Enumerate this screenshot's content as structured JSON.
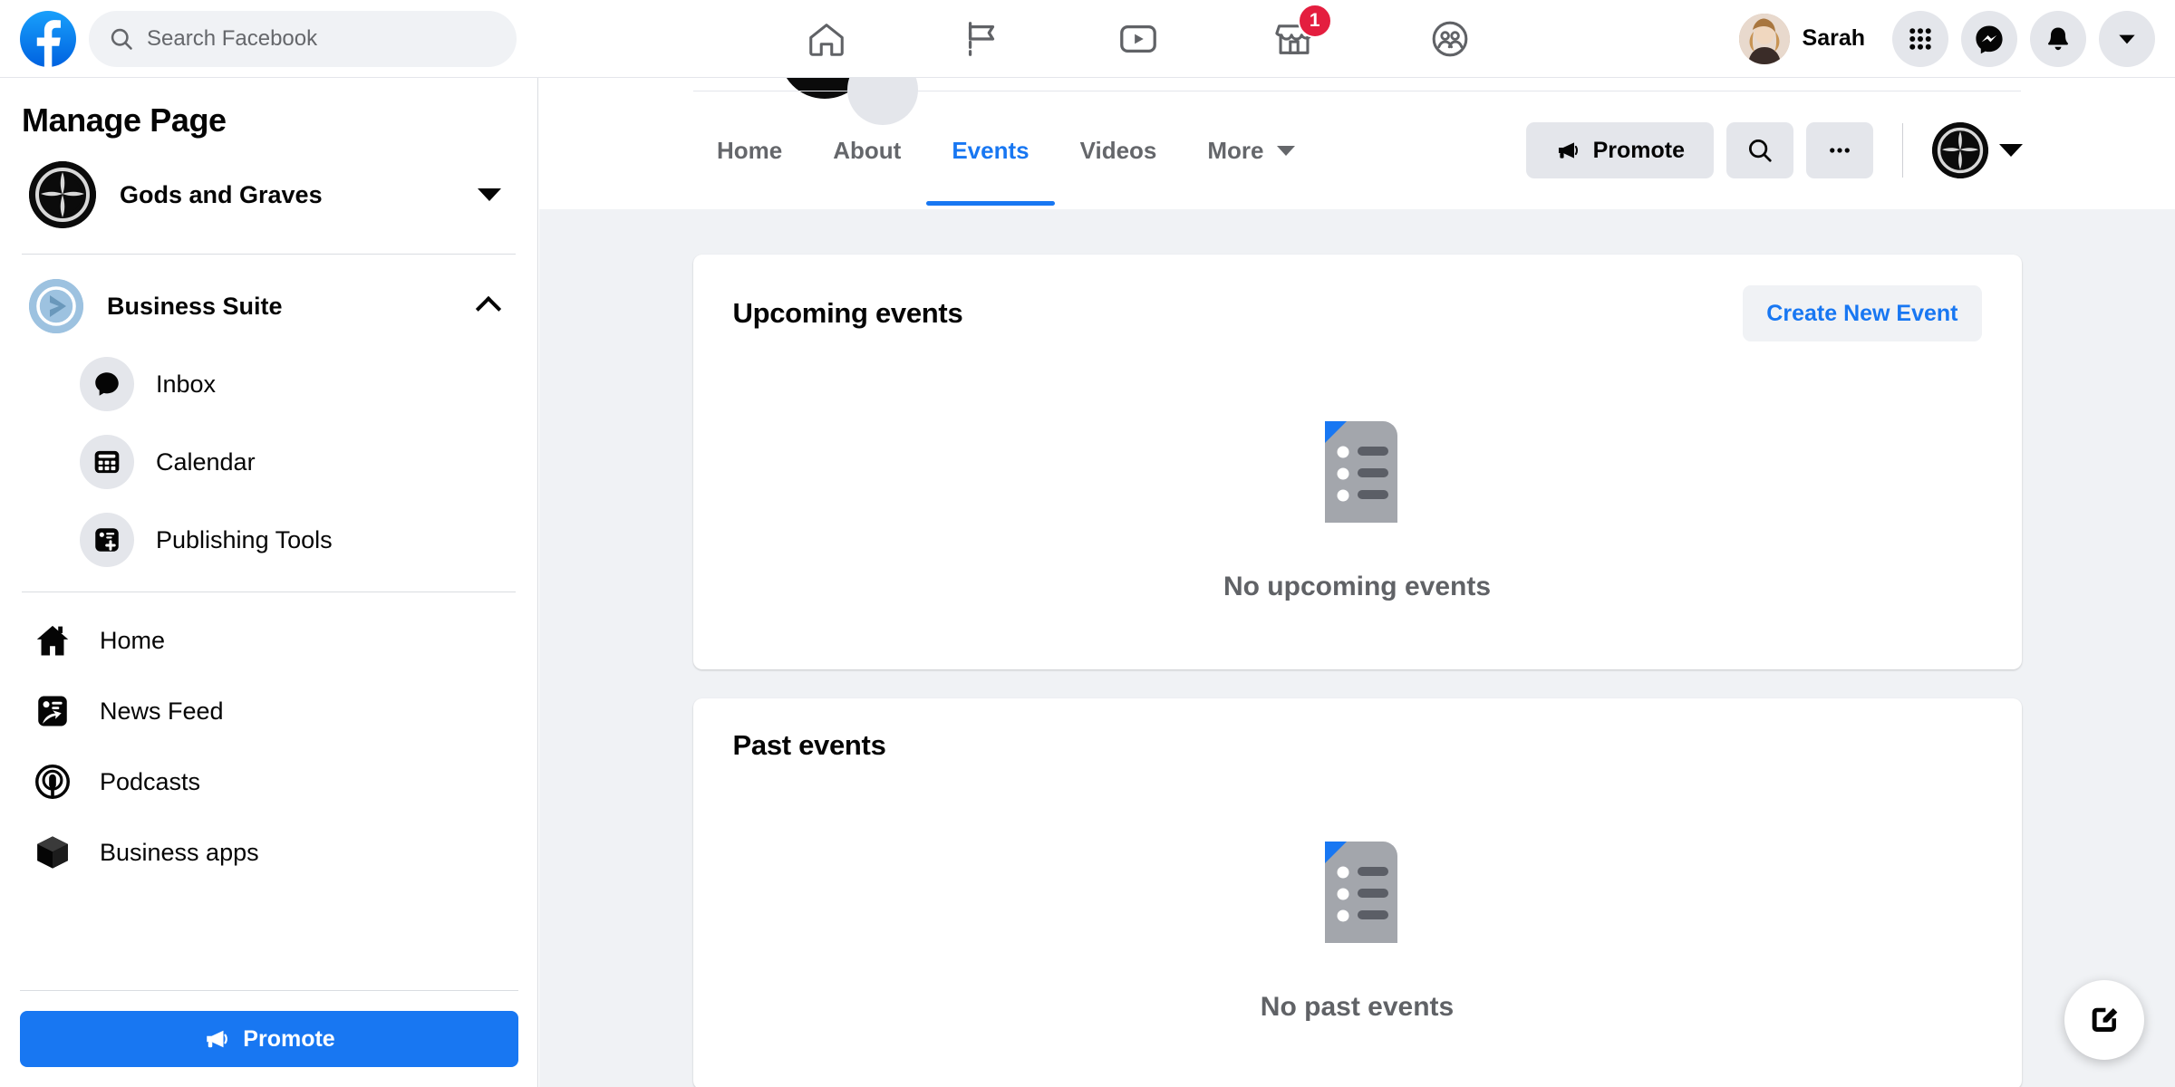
{
  "topbar": {
    "logo_icon": "facebook-logo",
    "search": {
      "placeholder": "Search Facebook",
      "value": "",
      "icon": "search-icon"
    },
    "nav": [
      {
        "icon": "home-icon",
        "name": "home",
        "badge": ""
      },
      {
        "icon": "flag-icon",
        "name": "pages",
        "badge": ""
      },
      {
        "icon": "video-play-icon",
        "name": "watch",
        "badge": ""
      },
      {
        "icon": "marketplace-store-icon",
        "name": "marketplace",
        "badge": "1"
      },
      {
        "icon": "groups-people-icon",
        "name": "groups",
        "badge": ""
      }
    ],
    "user": {
      "name": "Sarah",
      "avatar_icon": "user-avatar"
    },
    "actions": [
      {
        "icon": "grid-menu-icon",
        "name": "menu"
      },
      {
        "icon": "messenger-icon",
        "name": "messenger"
      },
      {
        "icon": "bell-icon",
        "name": "notifications"
      },
      {
        "icon": "chevron-down-icon",
        "name": "account"
      }
    ]
  },
  "sidebar": {
    "title": "Manage Page",
    "page": {
      "name": "Gods and Graves",
      "logo_icon": "gods-and-graves-logo",
      "caret_icon": "caret-down-icon"
    },
    "business_suite": {
      "label": "Business Suite",
      "icon": "business-suite-icon",
      "chevron_icon": "chevron-up-icon",
      "expanded": true,
      "items": [
        {
          "label": "Inbox",
          "icon": "chat-bubble-icon"
        },
        {
          "label": "Calendar",
          "icon": "calendar-icon"
        },
        {
          "label": "Publishing Tools",
          "icon": "publishing-tools-icon"
        }
      ]
    },
    "nav_items": [
      {
        "label": "Home",
        "icon": "home-filled-icon"
      },
      {
        "label": "News Feed",
        "icon": "news-feed-icon"
      },
      {
        "label": "Podcasts",
        "icon": "podcast-mic-icon"
      },
      {
        "label": "Business apps",
        "icon": "box-cube-icon"
      }
    ],
    "promote": {
      "label": "Promote",
      "icon": "megaphone-icon",
      "color": "#1877f2"
    }
  },
  "page_nav": {
    "tabs": [
      {
        "label": "Home",
        "active": false
      },
      {
        "label": "About",
        "active": false
      },
      {
        "label": "Events",
        "active": true
      },
      {
        "label": "Videos",
        "active": false
      },
      {
        "label": "More",
        "active": false,
        "has_caret": true
      }
    ],
    "actions": {
      "promote_label": "Promote",
      "promote_icon": "megaphone-icon",
      "search_icon": "search-icon",
      "more_icon": "ellipsis-icon",
      "page_switcher_icon": "gods-and-graves-logo",
      "page_switcher_caret": "caret-down-icon"
    },
    "active_color": "#1877f2"
  },
  "main": {
    "cards": [
      {
        "title": "Upcoming events",
        "action_label": "Create New Event",
        "empty_text": "No upcoming events",
        "empty_icon": "event-list-document-icon"
      },
      {
        "title": "Past events",
        "action_label": "",
        "empty_text": "No past events",
        "empty_icon": "event-list-document-icon"
      }
    ],
    "fab": {
      "icon": "compose-edit-icon"
    }
  }
}
